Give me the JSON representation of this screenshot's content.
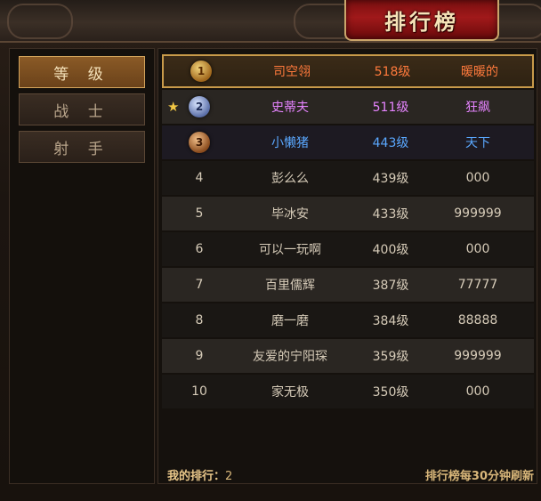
{
  "title": "排行榜",
  "categories": [
    {
      "label": "等 级",
      "active": true
    },
    {
      "label": "战 士",
      "active": false
    },
    {
      "label": "射 手",
      "active": false
    }
  ],
  "rankings": [
    {
      "rank": "1",
      "name": "司空翎",
      "level": "518级",
      "guild": "暖暖的",
      "medal": "gold-medal-icon"
    },
    {
      "rank": "2",
      "name": "史蒂夫",
      "level": "511级",
      "guild": "狂飙",
      "medal": "silver-medal-icon",
      "starred": true
    },
    {
      "rank": "3",
      "name": "小懒猪",
      "level": "443级",
      "guild": "天下",
      "medal": "bronze-medal-icon"
    },
    {
      "rank": "4",
      "name": "彭么么",
      "level": "439级",
      "guild": "000"
    },
    {
      "rank": "5",
      "name": "毕冰安",
      "level": "433级",
      "guild": "999999"
    },
    {
      "rank": "6",
      "name": "可以一玩啊",
      "level": "400级",
      "guild": "000"
    },
    {
      "rank": "7",
      "name": "百里儒辉",
      "level": "387级",
      "guild": "77777"
    },
    {
      "rank": "8",
      "name": "磨一磨",
      "level": "384级",
      "guild": "88888"
    },
    {
      "rank": "9",
      "name": "友爱的宁阳琛",
      "level": "359级",
      "guild": "999999"
    },
    {
      "rank": "10",
      "name": "家无极",
      "level": "350级",
      "guild": "000"
    }
  ],
  "footer": {
    "my_rank_label": "我的排行：",
    "my_rank_value": "2",
    "refresh_note": "排行榜每30分钟刷新"
  },
  "colors": {
    "rank1": "#ff7a3c",
    "rank2": "#e684ff",
    "rank3": "#5aa8ff",
    "normal": "#d6cbb8",
    "accent_gold": "#c89a4a"
  }
}
